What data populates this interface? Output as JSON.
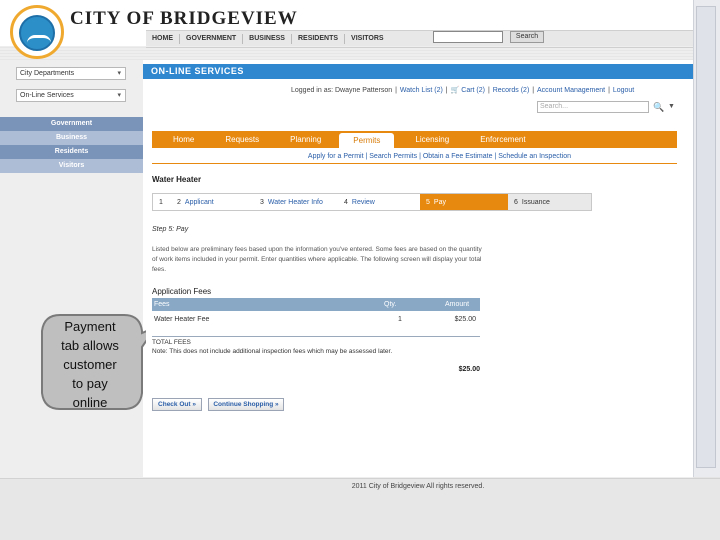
{
  "site": {
    "title": "City of Bridgeview",
    "logo_text": "CITY OF BRIDGEVIEW"
  },
  "topnav": {
    "items": [
      "HOME",
      "GOVERNMENT",
      "BUSINESS",
      "RESIDENTS",
      "VISITORS"
    ],
    "search_button": "Search"
  },
  "left": {
    "dropdown1": "City Departments",
    "dropdown2": "On-Line Services",
    "nav": [
      "Government",
      "Business",
      "Residents",
      "Visitors"
    ]
  },
  "ols_title": "ON-LINE SERVICES",
  "account": {
    "logged_in": "Logged in as: Dwayne Patterson",
    "watch_list": "Watch List (2)",
    "cart": "Cart (2)",
    "records": "Records (2)",
    "account_management": "Account Management",
    "logout": "Logout",
    "search_placeholder": "Search..."
  },
  "tabs": [
    "Home",
    "Requests",
    "Planning",
    "Permits",
    "Licensing",
    "Enforcement"
  ],
  "active_tab": "Permits",
  "subnav": [
    "Apply for a Permit",
    "Search Permits",
    "Obtain a Fee Estimate",
    "Schedule an Inspection"
  ],
  "page_title": "Water Heater",
  "steps": [
    {
      "num": "1",
      "label": ""
    },
    {
      "num": "2",
      "label": "Applicant"
    },
    {
      "num": "3",
      "label": "Water Heater Info"
    },
    {
      "num": "4",
      "label": "Review"
    },
    {
      "num": "5",
      "label": "Pay"
    },
    {
      "num": "6",
      "label": "Issuance"
    }
  ],
  "step_heading": "Step 5: Pay",
  "intro_text": "Listed below are preliminary fees based upon the information you've entered. Some fees are based on the quantity of work items included in your permit. Enter quantities where applicable. The following screen will display your total fees.",
  "fees": {
    "heading": "Application Fees",
    "col_fees": "Fees",
    "col_qty": "Qty.",
    "col_amount": "Amount",
    "rows": [
      {
        "label": "Water Heater Fee",
        "qty": "1",
        "amount": "$25.00"
      }
    ],
    "totals_label": "TOTAL FEES",
    "note": "Note: This does not include additional inspection fees which may be assessed later.",
    "total": "$25.00"
  },
  "buttons": {
    "check_out": "Check Out »",
    "continue_shopping": "Continue Shopping »"
  },
  "footer": "2011 City of Bridgeview All rights reserved.",
  "callout": {
    "line1": "Payment",
    "line2": "tab allows",
    "line3": "customer",
    "line4": "to pay",
    "line5": "online"
  },
  "colors": {
    "accent_orange": "#e8890f",
    "header_blue": "#2f87d0",
    "nav_blue": "#7a93b8",
    "link_blue": "#2a5ea8"
  }
}
